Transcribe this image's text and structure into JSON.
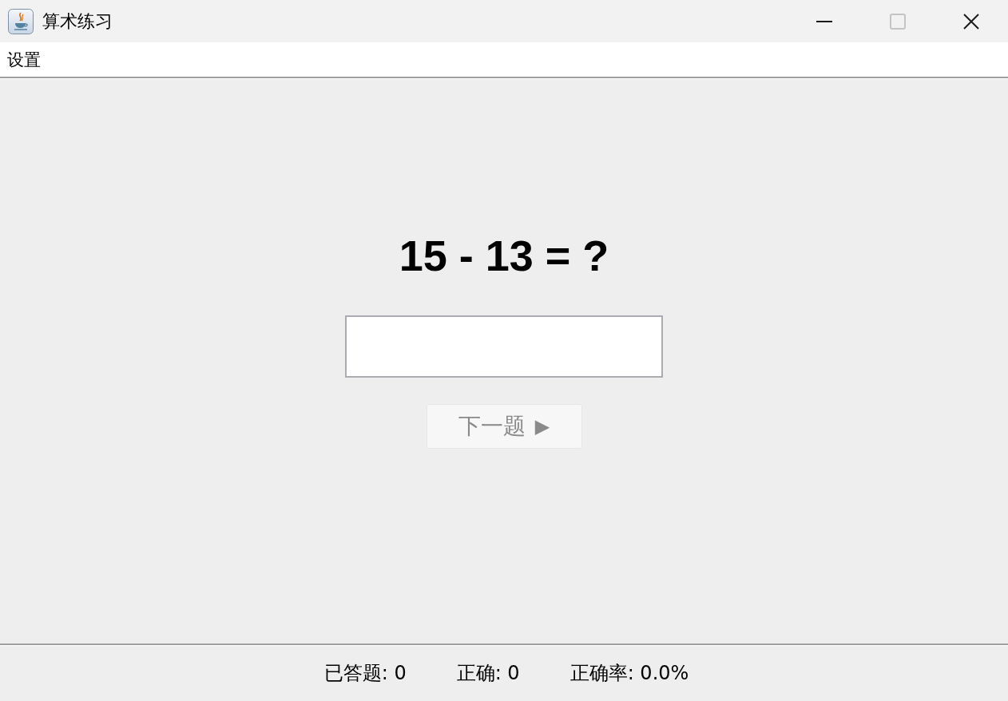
{
  "window": {
    "title": "算术练习",
    "controls": [
      {
        "kind": "minimize",
        "disabled": false
      },
      {
        "kind": "maximize",
        "disabled": true
      },
      {
        "kind": "close",
        "disabled": false
      }
    ]
  },
  "menu_bar": {
    "items": [
      "设置"
    ]
  },
  "question": {
    "text": "15 - 13 = ?"
  },
  "next_button": {
    "label": "下一题",
    "icon": "▶",
    "disabled": true
  },
  "status_bar": {
    "items": [
      "已答题: 0",
      "正确: 0",
      "正确率: 0.0%"
    ]
  }
}
